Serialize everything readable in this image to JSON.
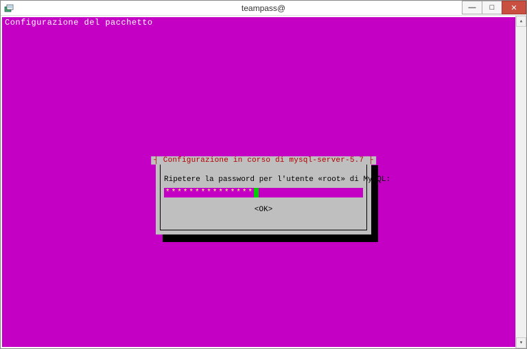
{
  "window": {
    "title": "teampass@"
  },
  "terminal": {
    "header": "Configurazione del pacchetto"
  },
  "dialog": {
    "title_decorated": "┤ Configurazione in corso di mysql-server-5.7 ├",
    "prompt": "Ripetere la password per l'utente «root» di MySQL:",
    "password_mask": "***************",
    "ok_label": "<OK>"
  },
  "controls": {
    "min": "—",
    "max": "□",
    "close": "✕",
    "up": "▴",
    "down": "▾"
  }
}
